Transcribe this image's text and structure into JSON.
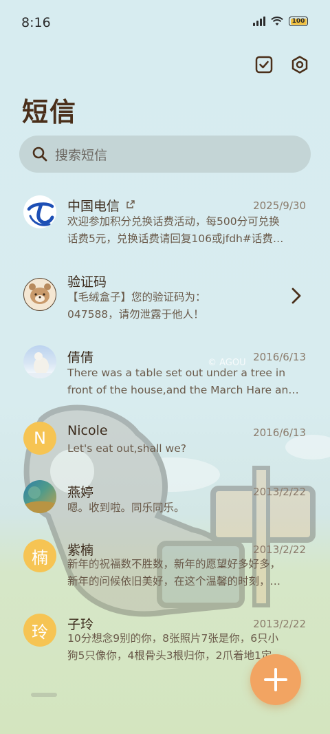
{
  "status": {
    "time": "8:16",
    "battery": "100"
  },
  "header": {
    "title": "短信"
  },
  "search": {
    "placeholder": "搜索短信"
  },
  "watermark": "© AGOU",
  "conversations": [
    {
      "avatar": "telecom-logo",
      "name": "中国电信",
      "date": "2025/9/30",
      "preview": [
        "欢迎参加积分兑换话费活动，每500分可兑换",
        "话费5元，兑换话费请回复106或jfdh#话费…"
      ]
    },
    {
      "avatar": "bear-avatar",
      "name": "验证码",
      "date": "",
      "preview": [
        "【毛绒盒子】您的验证码为：",
        "047588，请勿泄露于他人！"
      ]
    },
    {
      "avatar": "polar-bear-photo",
      "name": "倩倩",
      "date": "2016/6/13",
      "preview": [
        "There was a table set out under a tree in",
        "front of the house,and the March Hare an…"
      ]
    },
    {
      "avatar": "N",
      "name": "Nicole",
      "date": "2016/6/13",
      "preview": [
        "Let's eat out,shall we?"
      ]
    },
    {
      "avatar": "landscape-photo",
      "name": "燕婷",
      "date": "2013/2/22",
      "preview": [
        "嗯。收到啦。同乐同乐。"
      ]
    },
    {
      "avatar": "楠",
      "name": "紫楠",
      "date": "2013/2/22",
      "preview": [
        "新年的祝福数不胜数，新年的愿望好多好多，",
        "新年的问候依旧美好，在这个温馨的时刻，…"
      ]
    },
    {
      "avatar": "玲",
      "name": "子玲",
      "date": "2013/2/22",
      "preview": [
        "10分想念9别的你，8张照片7张是你，6只小",
        "狗5只像你，4根骨头3根归你，2爪着地1定…"
      ]
    }
  ],
  "colors": {
    "accent": "#f2a462",
    "letter_avatar": "#f6c453",
    "title": "#4a2f1a"
  }
}
